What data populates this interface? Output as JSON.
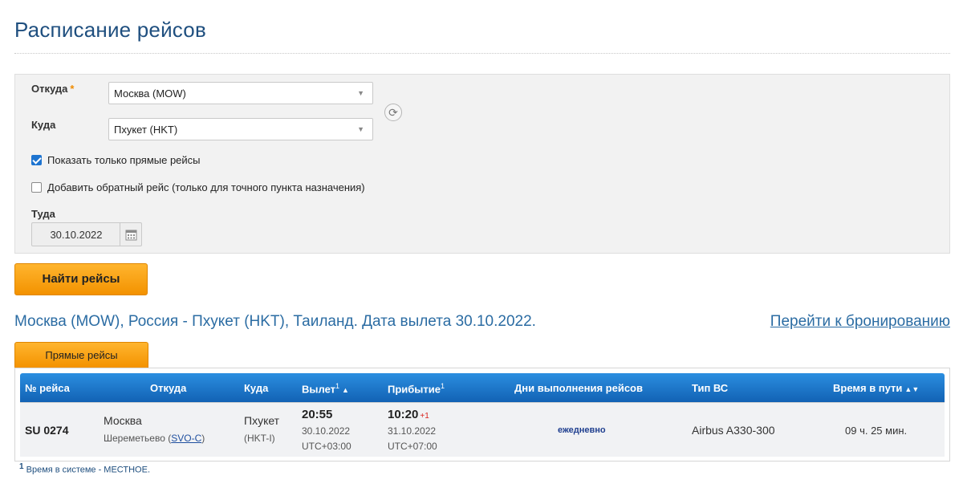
{
  "page": {
    "title": "Расписание рейсов"
  },
  "search": {
    "from_label": "Откуда",
    "required_mark": "*",
    "from_value": "Москва (MOW)",
    "to_label": "Куда",
    "to_value": "Пхукет (HKT)",
    "direct_only_label": "Показать только прямые рейсы",
    "direct_only_checked": true,
    "return_label": "Добавить обратный рейс (только для точного пункта назначения)",
    "return_checked": false,
    "date_label": "Туда",
    "date_value": "30.10.2022",
    "find_button": "Найти рейсы"
  },
  "results": {
    "summary": "Москва (MOW), Россия - Пхукет (HKT), Таиланд. Дата вылета 30.10.2022.",
    "booking_link": "Перейти к бронированию",
    "tab_direct": "Прямые рейсы",
    "columns": {
      "flight_no": "№ рейса",
      "from": "Откуда",
      "to": "Куда",
      "departure": "Вылет",
      "departure_sup": "1",
      "arrival": "Прибытие",
      "arrival_sup": "1",
      "days": "Дни выполнения рейсов",
      "aircraft": "Тип ВС",
      "duration": "Время в пути"
    },
    "rows": [
      {
        "flight_no": "SU 0274",
        "from_city": "Москва",
        "from_airport": "Шереметьево",
        "from_code": "SVO-C",
        "to_city": "Пхукет",
        "to_code": "(HKT-I)",
        "dep_time": "20:55",
        "dep_date": "30.10.2022",
        "dep_tz": "UTC+03:00",
        "arr_time": "10:20",
        "arr_plus": "+1",
        "arr_date": "31.10.2022",
        "arr_tz": "UTC+07:00",
        "days": "ежедневно",
        "aircraft": "Airbus A330-300",
        "duration": "09 ч. 25 мин."
      }
    ],
    "footnote_mark": "1",
    "footnote": "Время в системе - МЕСТНОЕ."
  }
}
